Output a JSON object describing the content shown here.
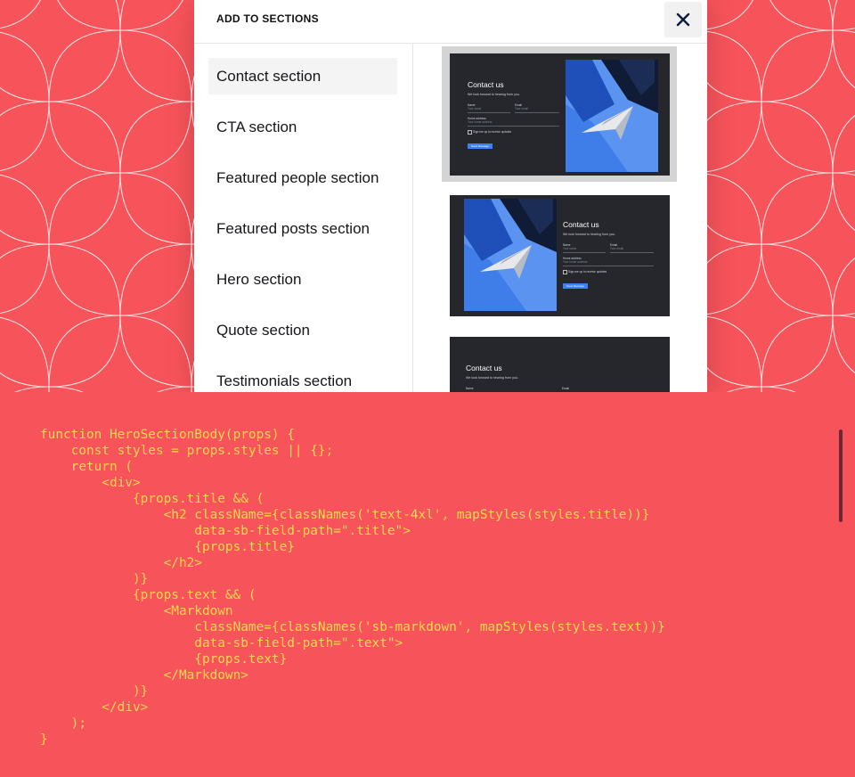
{
  "modal": {
    "title": "ADD TO SECTIONS",
    "close_icon": "close-icon",
    "sections": [
      {
        "label": "Contact section",
        "selected": true
      },
      {
        "label": "CTA section",
        "selected": false
      },
      {
        "label": "Featured people section",
        "selected": false
      },
      {
        "label": "Featured posts section",
        "selected": false
      },
      {
        "label": "Hero section",
        "selected": false
      },
      {
        "label": "Quote section",
        "selected": false
      },
      {
        "label": "Testimonials section",
        "selected": false
      }
    ]
  },
  "previews": [
    {
      "heading": "Contact us",
      "subtitle": "We look forward to hearing from you.",
      "name_label": "Name",
      "name_placeholder": "Your name",
      "email_label": "Email",
      "email_placeholder": "Your email",
      "home_label": "Home address",
      "home_placeholder": "Your home address",
      "checkbox_label": "Sign me up to receive updates",
      "button_label": "Send Message"
    },
    {
      "heading": "Contact us",
      "subtitle": "We look forward to hearing from you.",
      "name_label": "Name",
      "name_placeholder": "Your name",
      "email_label": "Email",
      "email_placeholder": "Your email",
      "home_label": "Home address",
      "home_placeholder": "Your home address",
      "checkbox_label": "Sign me up to receive updates",
      "button_label": "Send Message"
    },
    {
      "heading": "Contact us",
      "subtitle": "We look forward to hearing from you.",
      "name_label": "Name",
      "email_label": "Email"
    }
  ],
  "code_lines": [
    "function HeroSectionBody(props) {",
    "    const styles = props.styles || {};",
    "    return (",
    "        <div>",
    "            {props.title && (",
    "                <h2 className={classNames('text-4xl', mapStyles(styles.title))}",
    "                    data-sb-field-path=\".title\">",
    "                    {props.title}",
    "                </h2>",
    "            )}",
    "            {props.text && (",
    "                <Markdown",
    "                    className={classNames('sb-markdown', mapStyles(styles.text))}",
    "                    data-sb-field-path=\".text\">",
    "                    {props.text}",
    "                </Markdown>",
    "            )}",
    "        </div>",
    "    );",
    "}"
  ],
  "colors": {
    "background": "#f7535a",
    "code_text": "#ffd84d",
    "thumb_bg": "#25272d",
    "accent_blue": "#3b82f6"
  }
}
